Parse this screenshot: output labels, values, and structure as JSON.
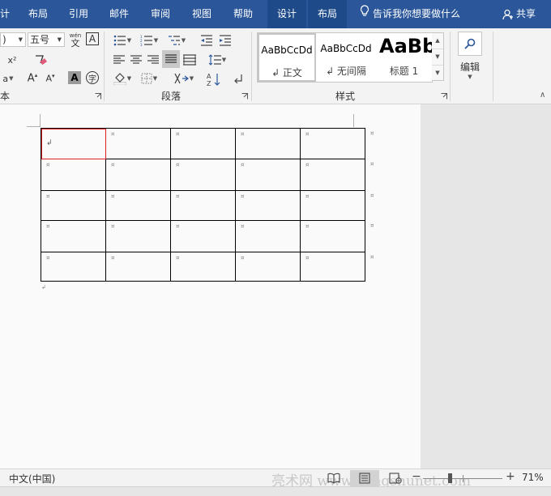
{
  "tabs": {
    "t0": "计",
    "t1": "布局",
    "t2": "引用",
    "t3": "邮件",
    "t4": "审阅",
    "t5": "视图",
    "t6": "帮助",
    "t7": "设计",
    "t8": "布局"
  },
  "tell_me": "告诉我你想要做什么",
  "share": "共享",
  "font": {
    "name_value": ")",
    "size_value": "五号",
    "group_label": "本",
    "phonetic_top": "wén",
    "phonetic_bottom": "文",
    "char_border": "A",
    "enclose": "字"
  },
  "paragraph": {
    "group_label": "段落"
  },
  "styles": {
    "group_label": "样式",
    "items": [
      {
        "sample": "AaBbCcDd",
        "name": "↲ 正文"
      },
      {
        "sample": "AaBbCcDd",
        "name": "↲ 无间隔"
      },
      {
        "sample": "AaBb",
        "name": "标题 1"
      }
    ]
  },
  "editing": {
    "label": "编辑"
  },
  "document": {
    "table_rows": 5,
    "table_cols": 5
  },
  "status": {
    "language": "中文(中国)",
    "watermark": "亮术网 www.liangshunet.com",
    "zoom": "71%"
  },
  "colors": {
    "tab_bar": "#2b579a",
    "context_tab": "#1e4a8a",
    "active_cell_border": "#e02020"
  }
}
